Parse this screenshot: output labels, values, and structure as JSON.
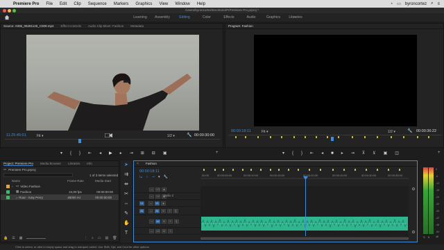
{
  "menubar": {
    "app_name": "Premiere Pro",
    "items": [
      "File",
      "Edit",
      "Clip",
      "Sequence",
      "Markers",
      "Graphics",
      "View",
      "Window",
      "Help"
    ],
    "user": "byroncortez"
  },
  "window": {
    "title": "/Users/byroncortez/Escritorio/PrPremiere Pro.prproj *"
  },
  "workspaces": {
    "tabs": [
      "Learning",
      "Assembly",
      "Editing",
      "Color",
      "Effects",
      "Audio",
      "Graphics",
      "Libraries"
    ],
    "active": "Editing",
    "more": "»"
  },
  "source_panel": {
    "tabs": [
      "Source: A006_06281125_C009.mp4",
      "Effect Controls",
      "Audio Clip Mixer: Fashion",
      "Metadata"
    ],
    "timecode_in": "11:25:45:01",
    "fit": "Fit",
    "resolution": "1/2",
    "timecode_out": "00:00:30:00"
  },
  "program_panel": {
    "tabs": [
      "Program: Fashion"
    ],
    "timecode_in": "00:00:18:11",
    "fit": "Fit",
    "resolution": "1/2",
    "timecode_out": "00:00:36:22"
  },
  "project_panel": {
    "tabs": [
      "Project: Premiere Pro",
      "Media Browser",
      "Libraries",
      "Info"
    ],
    "project_file": "Premiere Pro.prproj",
    "selection_info": "1 of 3 items selected",
    "columns": [
      "Name",
      "Frame Rate",
      "Media Start"
    ],
    "items": [
      {
        "name": "Video Fashion",
        "frame_rate": "",
        "media_start": "",
        "color": "#e8a53a"
      },
      {
        "name": "Fashion",
        "frame_rate": "24,00 fps",
        "media_start": "00:00:00:00",
        "color": "#3fb86a"
      },
      {
        "name": "Roar - Katy Perry",
        "frame_rate": "48000 Hz",
        "media_start": "00:00:00:00",
        "color": "#3fb86a"
      }
    ]
  },
  "timeline": {
    "tab": "Fashion",
    "timecode": "00:00:18:11",
    "ruler_labels": [
      "00:00",
      "00:00:05:00",
      "00:00:10:00",
      "00:00:15:00",
      "00:00:20:00",
      "00:00:25:00",
      "00:00:30:00",
      "00:00:35:00"
    ],
    "tracks": [
      {
        "id": "V3"
      },
      {
        "id": "V2"
      },
      {
        "id": "V1"
      },
      {
        "id": "A1",
        "label": "Audio 1"
      },
      {
        "id": "A2",
        "label": "Audio 2"
      },
      {
        "id": "A3"
      }
    ],
    "source_patch": [
      "V1",
      "A1"
    ],
    "clip_color": "#2fb68f",
    "playhead_seconds": 18.46
  },
  "audio_meter": {
    "scale": [
      "0",
      "-6",
      "-12",
      "-18",
      "-24",
      "-30",
      "-36",
      "-42",
      "-48",
      "-54"
    ],
    "unit": "dB",
    "labels": [
      "S",
      "S"
    ]
  },
  "status_bar": {
    "text": "Click to select, or click in empty space and drag to marquee select. Use Shift, Opt, and Cmd for other options."
  },
  "colors": {
    "accent_blue": "#3d8ddb",
    "audio_clip": "#2fb68f",
    "panel_bg": "#232323"
  }
}
